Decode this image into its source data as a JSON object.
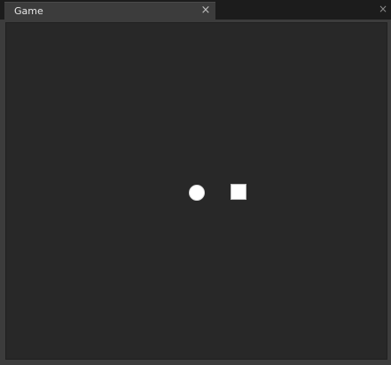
{
  "tab": {
    "title": "Game",
    "close_glyph": "×"
  },
  "pane": {
    "close_glyph": "×"
  },
  "game": {
    "objects": [
      {
        "shape": "circle",
        "color": "#ffffff"
      },
      {
        "shape": "square",
        "color": "#ffffff"
      }
    ]
  },
  "colors": {
    "viewport_background": "#282828",
    "frame": "#3c3c3c",
    "object": "#ffffff"
  }
}
